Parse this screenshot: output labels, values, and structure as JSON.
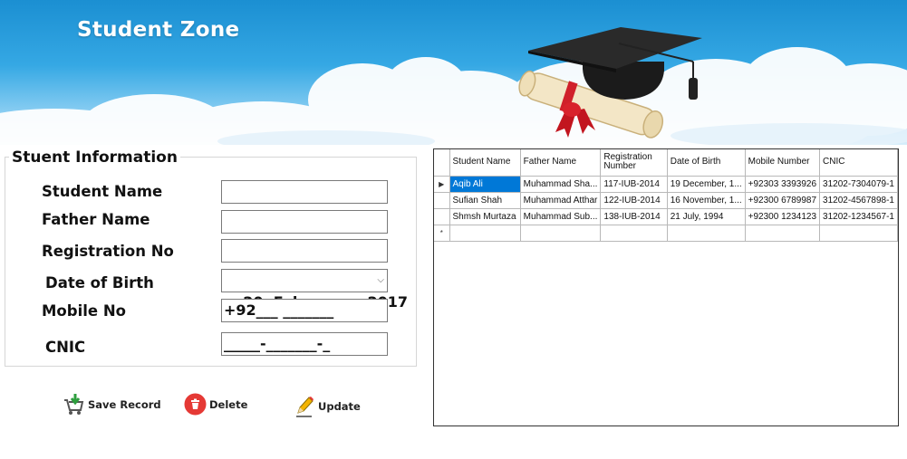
{
  "banner": {
    "title": "Student Zone"
  },
  "form": {
    "group_title": "Stuent Information",
    "student_name_label": "Student Name",
    "father_name_label": "Father Name",
    "registration_label": "Registration No",
    "dob_label": "Date of Birth",
    "mobile_label": "Mobile No",
    "cnic_label": "CNIC",
    "student_name_value": "",
    "father_name_value": "",
    "registration_value": "",
    "dob_value": "20  February  , 2017",
    "mobile_value": "+92___ _______",
    "cnic_value": "_____-_______-_"
  },
  "buttons": {
    "save": "Save Record",
    "delete": "Delete",
    "update": "Update"
  },
  "grid": {
    "columns": [
      "Student Name",
      "Father Name",
      "Registration Number",
      "Date of Birth",
      "Mobile Number",
      "CNIC"
    ],
    "rows": [
      [
        "Aqib Ali",
        "Muhammad Sha...",
        "117-IUB-2014",
        "19 December, 1...",
        "+92303 3393926",
        "31202-7304079-1"
      ],
      [
        "Sufian Shah",
        "Muhammad Atthar",
        "122-IUB-2014",
        "16 November, 1...",
        "+92300 6789987",
        "31202-4567898-1"
      ],
      [
        "Shmsh Murtaza",
        "Muhammad Sub...",
        "138-IUB-2014",
        "21 July, 1994",
        "+92300 1234123",
        "31202-1234567-1"
      ]
    ],
    "current_row_glyph": "▶",
    "new_row_glyph": "*",
    "selected_color": "#0078d7"
  },
  "colors": {
    "sky": "#35a8e4",
    "delete_red": "#e53935"
  }
}
